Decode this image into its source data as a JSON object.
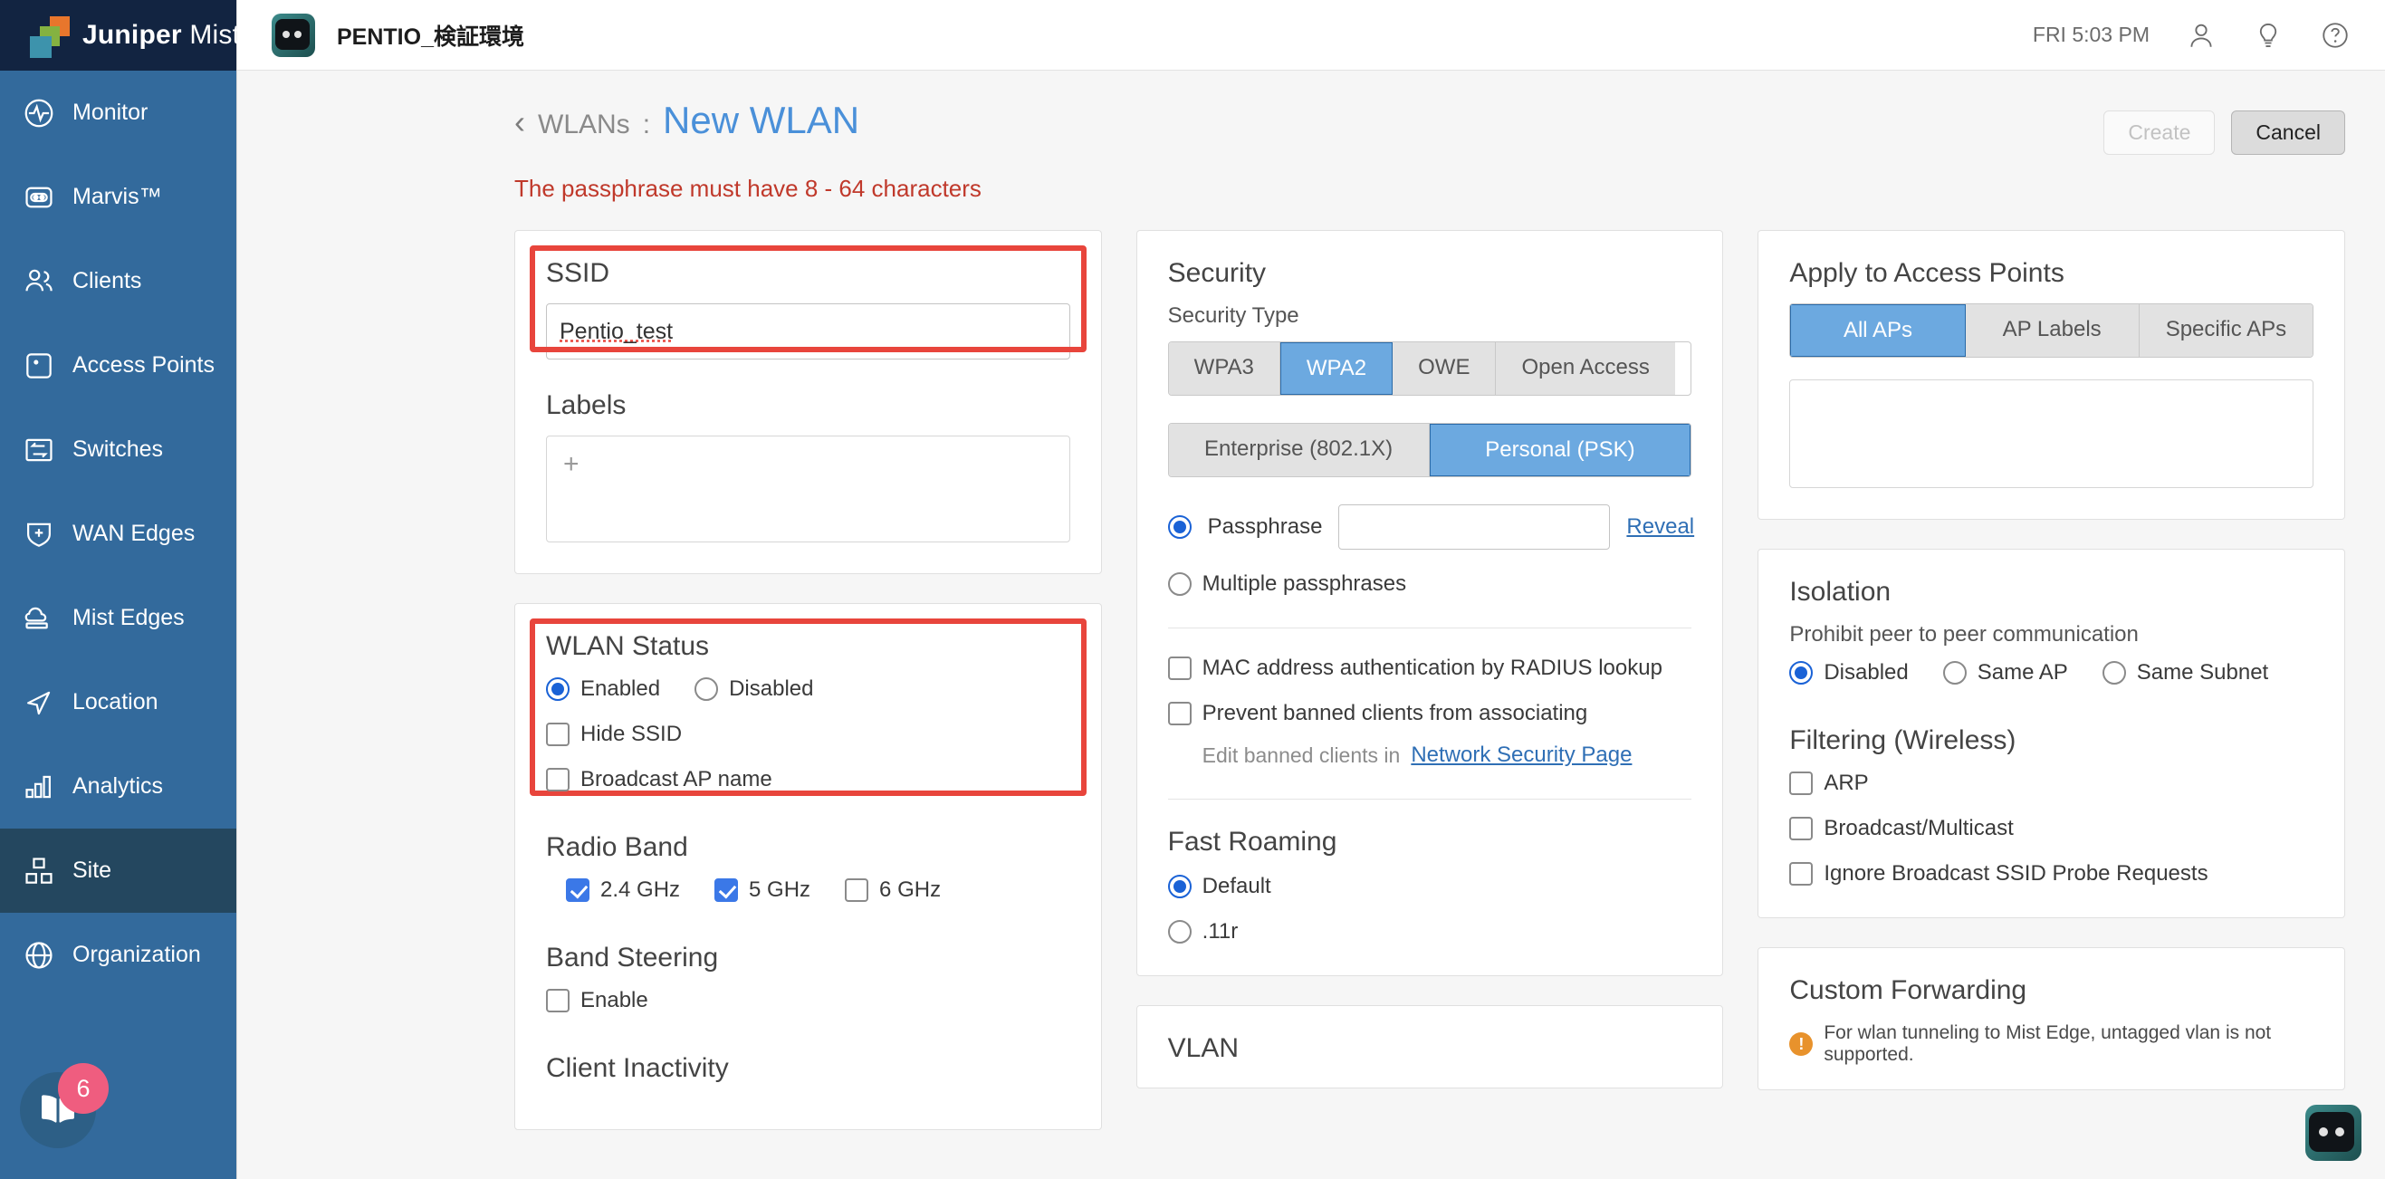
{
  "brand": {
    "name_bold": "Juniper",
    "name_light": "Mist",
    "tm": "™"
  },
  "topbar": {
    "site_title": "PENTIO_検証環境",
    "clock": "FRI 5:03 PM",
    "icons": [
      "user-icon",
      "lightbulb-icon",
      "help-icon"
    ]
  },
  "sidebar": {
    "items": [
      {
        "label": "Monitor",
        "icon": "monitor-pulse-icon",
        "active": false
      },
      {
        "label": "Marvis™",
        "icon": "marvis-icon",
        "active": false
      },
      {
        "label": "Clients",
        "icon": "clients-icon",
        "active": false
      },
      {
        "label": "Access Points",
        "icon": "access-point-icon",
        "active": false
      },
      {
        "label": "Switches",
        "icon": "switches-icon",
        "active": false
      },
      {
        "label": "WAN Edges",
        "icon": "wan-edge-shield-icon",
        "active": false
      },
      {
        "label": "Mist Edges",
        "icon": "mist-edge-cloud-icon",
        "active": false
      },
      {
        "label": "Location",
        "icon": "location-arrow-icon",
        "active": false
      },
      {
        "label": "Analytics",
        "icon": "analytics-bars-icon",
        "active": false
      },
      {
        "label": "Site",
        "icon": "site-squares-icon",
        "active": true
      },
      {
        "label": "Organization",
        "icon": "globe-icon",
        "active": false
      }
    ],
    "book_badge": "6"
  },
  "page": {
    "back_chevron": "‹",
    "breadcrumb_parent": "WLANs",
    "breadcrumb_sep": ":",
    "title": "New WLAN",
    "create_label": "Create",
    "cancel_label": "Cancel",
    "error": "The passphrase must have 8 - 64 characters"
  },
  "ssid_card": {
    "ssid_label": "SSID",
    "ssid_value": "Pentio_test",
    "labels_label": "Labels",
    "labels_add": "+"
  },
  "wlan_status": {
    "title": "WLAN Status",
    "enabled_label": "Enabled",
    "disabled_label": "Disabled",
    "status_selected": "Enabled",
    "hide_ssid_label": "Hide SSID",
    "hide_ssid_checked": false,
    "broadcast_ap_label": "Broadcast AP name",
    "broadcast_ap_checked": false,
    "radio_band_title": "Radio Band",
    "bands": [
      {
        "label": "2.4 GHz",
        "checked": true
      },
      {
        "label": "5 GHz",
        "checked": true
      },
      {
        "label": "6 GHz",
        "checked": false
      }
    ],
    "band_steering_title": "Band Steering",
    "band_steering_enable_label": "Enable",
    "band_steering_checked": false,
    "client_inactivity_title": "Client Inactivity"
  },
  "security": {
    "title": "Security",
    "type_label": "Security Type",
    "types": [
      "WPA3",
      "WPA2",
      "OWE",
      "Open Access"
    ],
    "type_selected": "WPA2",
    "modes": [
      "Enterprise (802.1X)",
      "Personal (PSK)"
    ],
    "mode_selected": "Personal (PSK)",
    "passphrase_label": "Passphrase",
    "passphrase_value": "",
    "reveal_label": "Reveal",
    "multiple_passphrases_label": "Multiple passphrases",
    "psk_mode_selected": "Passphrase",
    "mac_auth_label": "MAC address authentication by RADIUS lookup",
    "mac_auth_checked": false,
    "prevent_banned_label": "Prevent banned clients from associating",
    "prevent_banned_checked": false,
    "edit_banned_prefix": "Edit banned clients in",
    "edit_banned_link": "Network Security Page",
    "fast_roaming_title": "Fast Roaming",
    "fast_roaming_options": [
      "Default",
      ".11r"
    ],
    "fast_roaming_selected": "Default",
    "vlan_title": "VLAN"
  },
  "access_points": {
    "title": "Apply to Access Points",
    "tabs": [
      "All APs",
      "AP Labels",
      "Specific APs"
    ],
    "tab_selected": "All APs"
  },
  "isolation": {
    "title": "Isolation",
    "subtitle": "Prohibit peer to peer communication",
    "options": [
      "Disabled",
      "Same AP",
      "Same Subnet"
    ],
    "selected": "Disabled",
    "filtering_title": "Filtering (Wireless)",
    "filters": [
      {
        "label": "ARP",
        "checked": false
      },
      {
        "label": "Broadcast/Multicast",
        "checked": false
      },
      {
        "label": "Ignore Broadcast SSID Probe Requests",
        "checked": false
      }
    ]
  },
  "custom_forwarding": {
    "title": "Custom Forwarding",
    "warning": "For wlan tunneling to Mist Edge, untagged vlan is not supported."
  },
  "colors": {
    "brand_navy": "#122441",
    "sidebar_blue": "#336a9c",
    "accent_blue": "#4a90d9",
    "error_red": "#c0392b",
    "highlight_red": "#e8453c",
    "selected_blue": "#6ca9e0",
    "checkbox_blue": "#3b78e7"
  }
}
